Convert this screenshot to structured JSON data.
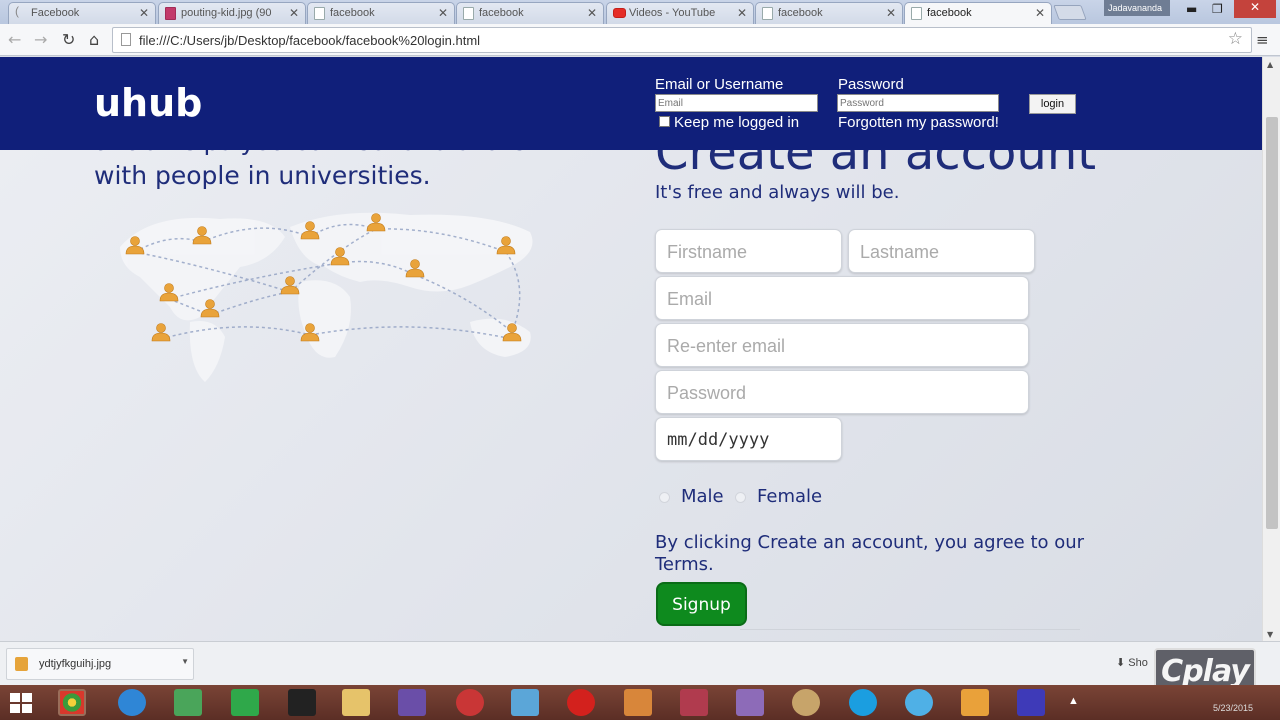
{
  "browser": {
    "tabs": [
      {
        "label": "Facebook",
        "icon": "page-icon"
      },
      {
        "label": "pouting-kid.jpg (90",
        "icon": "image-icon"
      },
      {
        "label": "facebook",
        "icon": "page-icon"
      },
      {
        "label": "facebook",
        "icon": "page-icon"
      },
      {
        "label": "Videos - YouTube",
        "icon": "youtube-icon"
      },
      {
        "label": "facebook",
        "icon": "page-icon"
      },
      {
        "label": "facebook",
        "icon": "page-icon",
        "active": true
      }
    ],
    "user": "Jadavananda",
    "address": "file:///C:/Users/jb/Desktop/facebook/facebook%20login.html"
  },
  "header": {
    "logo": "uhub",
    "email_label": "Email or Username",
    "email_placeholder": "Email",
    "password_label": "Password",
    "password_placeholder": "Password",
    "keep_logged_in": "Keep me logged in",
    "forgot": "Forgotten my password!",
    "login_button": "login"
  },
  "left": {
    "tagline_line1": "uhub helps you connect and share",
    "tagline_line2": "with people in universities."
  },
  "signup_form": {
    "title": "Create an account",
    "subtitle": "It's free and always will be.",
    "firstname_placeholder": "Firstname",
    "lastname_placeholder": "Lastname",
    "email_placeholder": "Email",
    "reenter_email_placeholder": "Re-enter email",
    "password_placeholder": "Password",
    "birthday": "mm/dd/yyyy",
    "gender_male": "Male",
    "gender_female": "Female",
    "terms": "By clicking Create an account, you agree to our Terms.",
    "signup_button": "Signup"
  },
  "downloads": {
    "file": "ydtjyfkguihj.jpg",
    "show_all": "Sho"
  },
  "watermark": "Cplay",
  "tray": {
    "date": "5/23/2015"
  },
  "colors": {
    "header_bg": "#101f7a",
    "text_navy": "#1f2d7a",
    "signup_green": "#0e8a1e"
  }
}
